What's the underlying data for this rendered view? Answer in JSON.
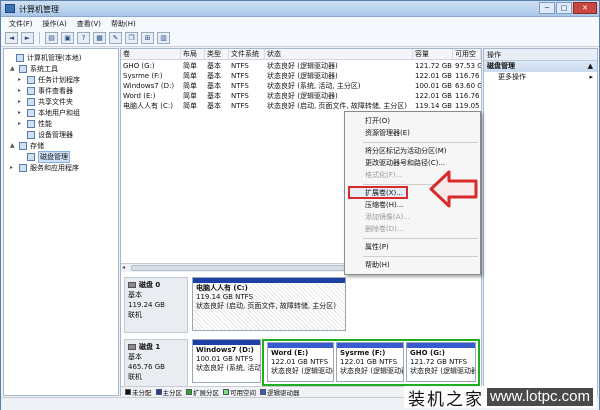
{
  "window": {
    "title": "计算机管理",
    "btn_min": "─",
    "btn_max": "□",
    "btn_close": "✕"
  },
  "menu": [
    "文件(F)",
    "操作(A)",
    "查看(V)",
    "帮助(H)"
  ],
  "toolbar": [
    "◄",
    "►",
    "▤",
    "▣",
    "?",
    "▦",
    "✎",
    "❐",
    "⊞",
    "▥"
  ],
  "tree": [
    {
      "label": "计算机管理(本地)",
      "exp": "",
      "sel": false
    },
    {
      "label": "系统工具",
      "exp": "▲",
      "sel": false
    },
    {
      "label": "任务计划程序",
      "exp": "▸",
      "sel": false
    },
    {
      "label": "事件查看器",
      "exp": "▸",
      "sel": false
    },
    {
      "label": "共享文件夹",
      "exp": "▸",
      "sel": false
    },
    {
      "label": "本地用户和组",
      "exp": "▸",
      "sel": false
    },
    {
      "label": "性能",
      "exp": "▸",
      "sel": false
    },
    {
      "label": "设备管理器",
      "exp": "",
      "sel": false
    },
    {
      "label": "存储",
      "exp": "▲",
      "sel": false
    },
    {
      "label": "磁盘管理",
      "exp": "",
      "sel": true
    },
    {
      "label": "服务和应用程序",
      "exp": "▸",
      "sel": false
    }
  ],
  "volume_table": {
    "headers": [
      "卷",
      "布局",
      "类型",
      "文件系统",
      "状态",
      "容量",
      "可用空"
    ],
    "rows": [
      [
        "GHO (G:)",
        "简单",
        "基本",
        "NTFS",
        "状态良好 (逻辑驱动器)",
        "121.72 GB",
        "97.53 G"
      ],
      [
        "Sysrme (F:)",
        "简单",
        "基本",
        "NTFS",
        "状态良好 (逻辑驱动器)",
        "122.01 GB",
        "116.76 G"
      ],
      [
        "Windows7 (D:)",
        "简单",
        "基本",
        "NTFS",
        "状态良好 (系统, 活动, 主分区)",
        "100.01 GB",
        "63.60 G"
      ],
      [
        "Word (E:)",
        "简单",
        "基本",
        "NTFS",
        "状态良好 (逻辑驱动器)",
        "122.01 GB",
        "116.76 G"
      ],
      [
        "电脑人人有 (C:)",
        "简单",
        "基本",
        "NTFS",
        "状态良好 (启动, 页面文件, 故障转储, 主分区)",
        "119.14 GB",
        "119.05 G"
      ]
    ]
  },
  "disks": [
    {
      "name": "磁盘 0",
      "type": "基本",
      "size": "119.24 GB",
      "state": "联机",
      "parts": [
        {
          "name": "电脑人人有 (C:)",
          "size": "119.14 GB NTFS",
          "status": "状态良好 (启动, 页面文件, 故障转储, 主分区)"
        }
      ]
    },
    {
      "name": "磁盘 1",
      "type": "基本",
      "size": "465.76 GB",
      "state": "联机",
      "parts": [
        {
          "name": "Windows7 (D:)",
          "size": "100.01 GB NTFS",
          "status": "状态良好 (系统, 活动, 主分"
        },
        {
          "name": "Word (E:)",
          "size": "122.01 GB NTFS",
          "status": "状态良好 (逻辑驱动器)"
        },
        {
          "name": "Sysrme (F:)",
          "size": "122.01 GB NTFS",
          "status": "状态良好 (逻辑驱动器)"
        },
        {
          "name": "GHO (G:)",
          "size": "121.72 GB NTFS",
          "status": "状态良好 (逻辑驱动器)"
        }
      ]
    }
  ],
  "legend": [
    {
      "label": "未分配",
      "color": "#111111"
    },
    {
      "label": "主分区",
      "color": "#1f3fa8"
    },
    {
      "label": "扩展分区",
      "color": "#2fa82f"
    },
    {
      "label": "可用空间",
      "color": "#7ee07e"
    },
    {
      "label": "逻辑驱动器",
      "color": "#3a5ad0"
    }
  ],
  "actions": {
    "header": "操作",
    "section": "磁盘管理",
    "more": "更多操作",
    "arrow": "▲",
    "more_arrow": "▸"
  },
  "context_menu": [
    {
      "label": "打开(O)",
      "disabled": false
    },
    {
      "label": "资源管理器(E)",
      "disabled": false
    },
    {
      "label": "将分区标记为活动分区(M)",
      "disabled": false
    },
    {
      "label": "更改驱动器号和路径(C)...",
      "disabled": false
    },
    {
      "label": "格式化(F)...",
      "disabled": true
    },
    {
      "label": "扩展卷(X)...",
      "disabled": false
    },
    {
      "label": "压缩卷(H)...",
      "disabled": false
    },
    {
      "label": "添加镜像(A)...",
      "disabled": true
    },
    {
      "label": "删除卷(D)...",
      "disabled": true
    },
    {
      "label": "属性(P)",
      "disabled": false
    },
    {
      "label": "帮助(H)",
      "disabled": false
    }
  ],
  "watermark": {
    "brand": "装机之家",
    "site": "www.lotpc.com"
  },
  "colors": {
    "primary": "#1f3fa8",
    "logical": "#3a5ad0",
    "extended": "#2fa82f",
    "highlight": "#d82a2a"
  }
}
